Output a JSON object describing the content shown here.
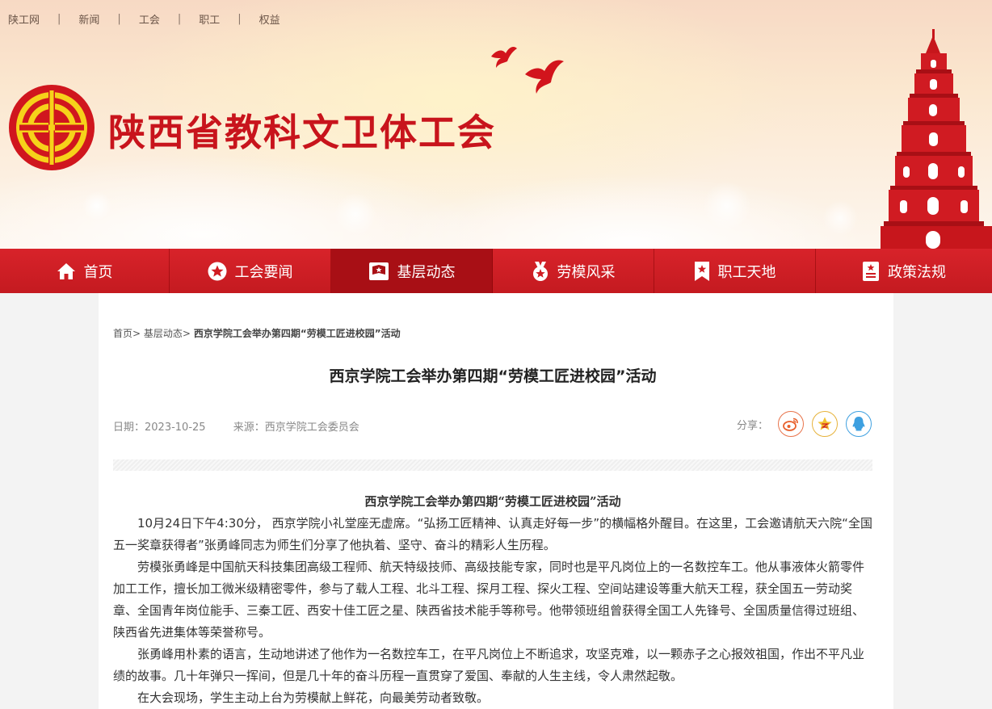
{
  "top_links": [
    "陕工网",
    "新闻",
    "工会",
    "职工",
    "权益"
  ],
  "top_separator": "|",
  "site_title": "陕西省教科文卫体工会",
  "colors": {
    "brand_red": "#c8141c",
    "nav_red": "#d8232a",
    "nav_active": "#a80f15"
  },
  "nav": [
    {
      "label": "首页",
      "icon": "home-icon"
    },
    {
      "label": "工会要闻",
      "icon": "star-badge-icon"
    },
    {
      "label": "基层动态",
      "icon": "flag-icon",
      "active": true
    },
    {
      "label": "劳模风采",
      "icon": "medal-icon"
    },
    {
      "label": "职工天地",
      "icon": "bookmark-icon"
    },
    {
      "label": "政策法规",
      "icon": "document-icon"
    }
  ],
  "breadcrumb": {
    "home": "首页",
    "sep": ">",
    "section": "基层动态",
    "current": "西京学院工会举办第四期“劳模工匠进校园”活动"
  },
  "article": {
    "title": "西京学院工会举办第四期“劳模工匠进校园”活动",
    "date_label": "日期：",
    "date": "2023-10-25",
    "source_label": "来源：",
    "source": "西京学院工会委员会",
    "share_label": "分享：",
    "share_icons": [
      "weibo-icon",
      "qzone-icon",
      "qq-icon"
    ],
    "subtitle": "西京学院工会举办第四期“劳模工匠进校园”活动",
    "paragraphs": [
      "10月24日下午4:30分， 西京学院小礼堂座无虚席。“弘扬工匠精神、认真走好每一步”的横幅格外醒目。在这里，工会邀请航天六院“全国五一奖章获得者”张勇峰同志为师生们分享了他执着、坚守、奋斗的精彩人生历程。",
      "劳模张勇峰是中国航天科技集团高级工程师、航天特级技师、高级技能专家，同时也是平凡岗位上的一名数控车工。他从事液体火箭零件加工工作，擅长加工微米级精密零件，参与了载人工程、北斗工程、探月工程、探火工程、空间站建设等重大航天工程，获全国五一劳动奖章、全国青年岗位能手、三秦工匠、西安十佳工匠之星、陕西省技术能手等称号。他带领班组曾获得全国工人先锋号、全国质量信得过班组、陕西省先进集体等荣誉称号。",
      "张勇峰用朴素的语言，生动地讲述了他作为一名数控车工，在平凡岗位上不断追求，攻坚克难，以一颗赤子之心报效祖国，作出不平凡业绩的故事。几十年弹只一挥间，但是几十年的奋斗历程一直贯穿了爱国、奉献的人生主线，令人肃然起敬。",
      "在大会现场，学生主动上台为劳模献上鲜花，向最美劳动者致敬。"
    ]
  }
}
